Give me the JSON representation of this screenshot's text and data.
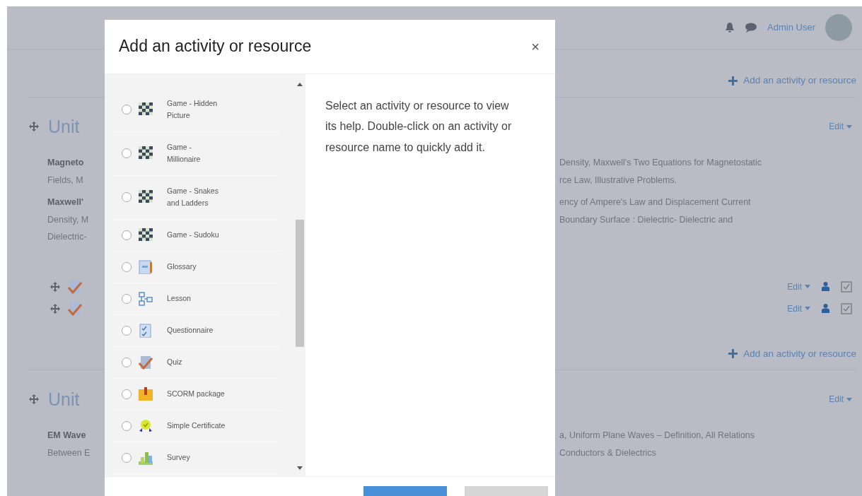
{
  "topbar": {
    "user": "Admin User"
  },
  "page": {
    "top_link": "Add an activity or resource",
    "sections": [
      {
        "title": "Unit",
        "edit": "Edit",
        "paragraphs": [
          {
            "left": [
              {
                "text": "Magneto",
                "bold": true
              },
              {
                "text": "Fields, M",
                "bold": false
              }
            ],
            "right": [
              "Density, Maxwell's Two Equations for Magnetostatic",
              "rce Law, Illustrative Problems."
            ]
          },
          {
            "left": [
              {
                "text": "Maxwell'",
                "bold": true
              },
              {
                "text": "Density, M",
                "bold": false
              },
              {
                "text": "Dielectric-",
                "bold": false
              }
            ],
            "right": [
              "ency of Ampere's Law and Displacement Current",
              "Boundary Surface : Dielectric- Dielectric and"
            ]
          }
        ],
        "activities": [
          {
            "edit": "Edit"
          },
          {
            "edit": "Edit"
          }
        ],
        "add_link": "Add an activity or resource"
      },
      {
        "title": "Unit",
        "edit": "Edit",
        "paragraphs": [
          {
            "left": [
              {
                "text": "EM Wave",
                "bold": true
              },
              {
                "text": "Between E",
                "bold": false
              }
            ],
            "right": [
              "a, Uniform Plane Waves – Definition, All Relations",
              "Conductors & Dielectrics"
            ]
          }
        ]
      }
    ]
  },
  "modal": {
    "title": "Add an activity or resource",
    "close": "×",
    "items": [
      {
        "label": "Game - Hidden Picture",
        "kind": "game",
        "selected": false
      },
      {
        "label": "Game - Millionaire",
        "kind": "game",
        "selected": false
      },
      {
        "label": "Game - Snakes and Ladders",
        "kind": "game",
        "selected": false
      },
      {
        "label": "Game - Sudoku",
        "kind": "game",
        "selected": false
      },
      {
        "label": "Glossary",
        "kind": "glossary",
        "selected": false
      },
      {
        "label": "Lesson",
        "kind": "lesson",
        "selected": false
      },
      {
        "label": "Questionnaire",
        "kind": "questionnaire",
        "selected": false
      },
      {
        "label": "Quiz",
        "kind": "quiz",
        "selected": false
      },
      {
        "label": "SCORM package",
        "kind": "scorm",
        "selected": false
      },
      {
        "label": "Simple Certificate",
        "kind": "certificate",
        "selected": false
      },
      {
        "label": "Survey",
        "kind": "survey",
        "selected": false
      }
    ],
    "help": "Select an activity or resource to view its help. Double-click on an activity or resource name to quickly add it."
  }
}
